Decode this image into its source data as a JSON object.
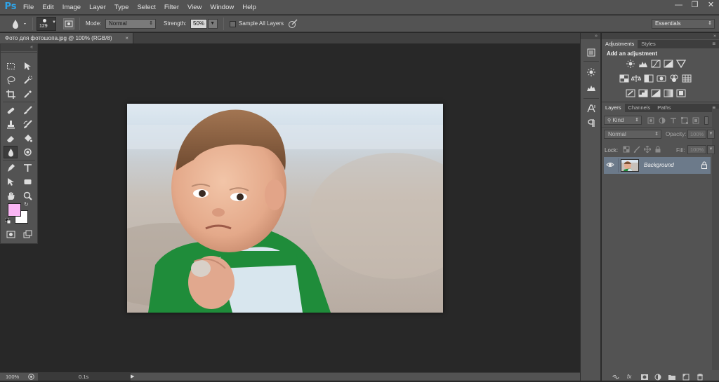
{
  "app": {
    "logo": "Ps",
    "menu": [
      "File",
      "Edit",
      "Image",
      "Layer",
      "Type",
      "Select",
      "Filter",
      "View",
      "Window",
      "Help"
    ]
  },
  "options_bar": {
    "brush_size": "129",
    "mode_label": "Mode:",
    "mode_value": "Normal",
    "strength_label": "Strength:",
    "strength_value": "50%",
    "sample_all_layers": "Sample All Layers",
    "workspace": "Essentials"
  },
  "document": {
    "tab_title": "Фото для фотошопа.jpg @ 100% (RGB/8)",
    "close": "×"
  },
  "status_bar": {
    "zoom": "100%",
    "timing": "0.1s"
  },
  "adjustments": {
    "tabs": [
      "Adjustments",
      "Styles"
    ],
    "heading": "Add an adjustment"
  },
  "layers": {
    "tabs": [
      "Layers",
      "Channels",
      "Paths"
    ],
    "kind_filter": "Kind",
    "blend_mode": "Normal",
    "opacity_label": "Opacity:",
    "opacity_value": "100%",
    "lock_label": "Lock:",
    "fill_label": "Fill:",
    "fill_value": "100%",
    "items": [
      {
        "name": "Background",
        "visible": true,
        "locked": true
      }
    ]
  },
  "colors": {
    "foreground": "#f9b5f3",
    "background": "#ffffff",
    "accent": "#2fa3e6",
    "selected_layer": "#6c7a8a"
  }
}
